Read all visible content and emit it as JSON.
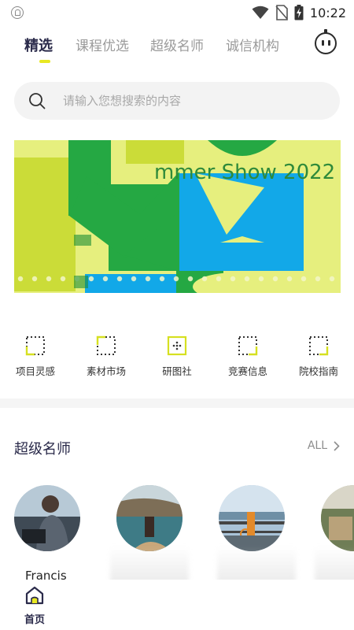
{
  "status_bar": {
    "time": "10:22",
    "icons": [
      "shield-icon",
      "wifi-icon",
      "no-sim-icon",
      "battery-charging-icon"
    ]
  },
  "tabs": [
    {
      "label": "精选",
      "active": true
    },
    {
      "label": "课程优选",
      "active": false
    },
    {
      "label": "超级名师",
      "active": false
    },
    {
      "label": "诚信机构",
      "active": false
    }
  ],
  "colors": {
    "accent_yellow": "#e8e823",
    "banner_green": "#25a843",
    "banner_blue": "#12a8e8",
    "banner_lime": "#e6ef7e",
    "title_dark": "#2a2a4a"
  },
  "search": {
    "placeholder": "请输入您想搜索的内容"
  },
  "banner": {
    "text": "mmer Show 2022"
  },
  "quick_entries": [
    {
      "label": "项目灵感",
      "icon": "dotted-square-icon"
    },
    {
      "label": "素材市场",
      "icon": "dotted-square-icon"
    },
    {
      "label": "研图社",
      "icon": "grid-square-icon"
    },
    {
      "label": "竞赛信息",
      "icon": "dotted-square-icon"
    },
    {
      "label": "院校指南",
      "icon": "dotted-square-icon"
    }
  ],
  "teachers_section": {
    "title": "超级名师",
    "all_label": "ALL",
    "teachers": [
      {
        "name": "Francis"
      }
    ]
  },
  "bottom_nav": {
    "home_label": "首页"
  }
}
